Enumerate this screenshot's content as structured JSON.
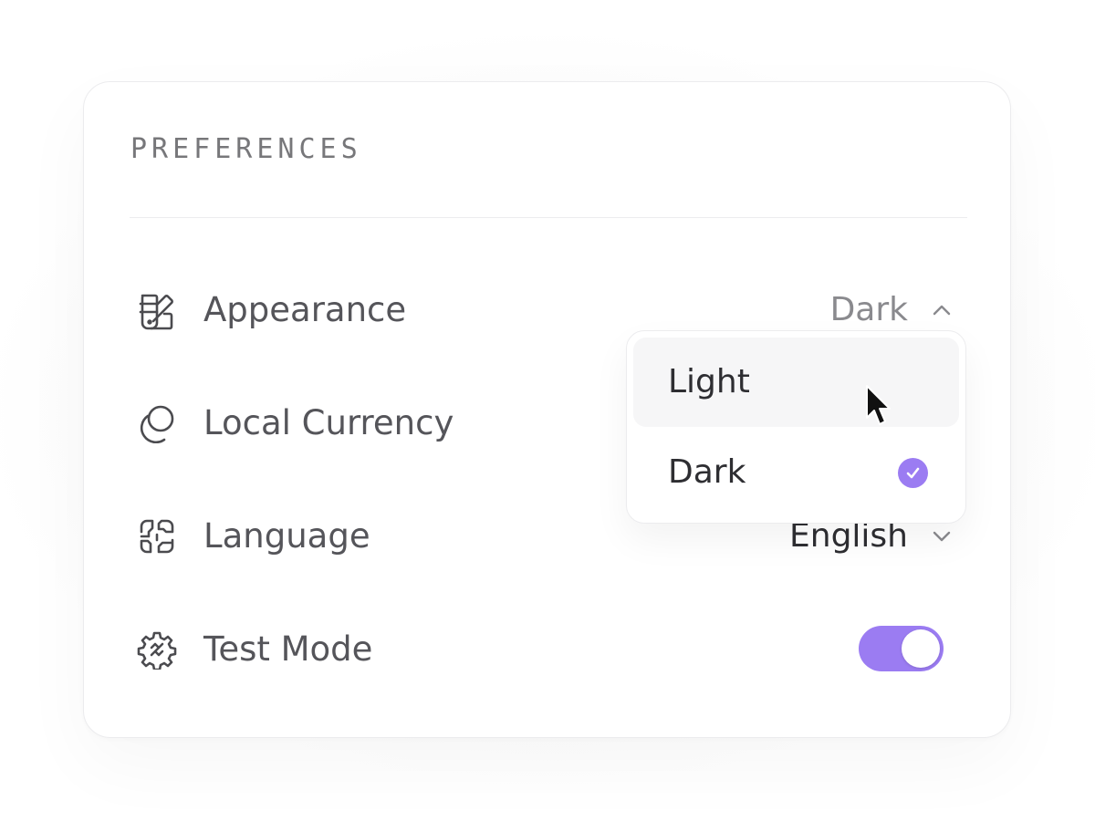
{
  "panel": {
    "title": "PREFERENCES"
  },
  "rows": [
    {
      "icon": "palette-icon",
      "label": "Appearance",
      "value": "Dark",
      "control": "dropdown-open"
    },
    {
      "icon": "currency-icon",
      "label": "Local Currency",
      "control": "dropdown"
    },
    {
      "icon": "globe-icon",
      "label": "Language",
      "value": "English",
      "control": "dropdown"
    },
    {
      "icon": "gear-icon",
      "label": "Test Mode",
      "control": "toggle",
      "toggle_on": true
    }
  ],
  "appearance_dropdown": {
    "options": [
      {
        "label": "Light",
        "hovered": true,
        "selected": false
      },
      {
        "label": "Dark",
        "hovered": false,
        "selected": true
      }
    ]
  },
  "colors": {
    "accent": "#9b7cf2",
    "text_primary": "#2e2e32",
    "text_secondary": "#55555a",
    "text_muted": "#77777a",
    "border": "#ececee"
  }
}
